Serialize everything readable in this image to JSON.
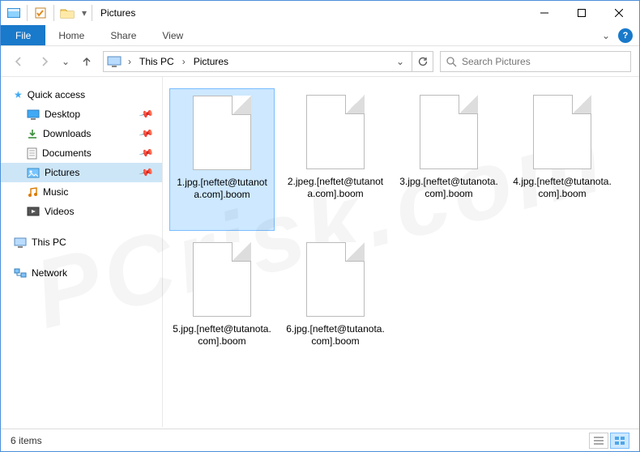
{
  "title": "Pictures",
  "ribbon": {
    "file": "File",
    "tabs": [
      "Home",
      "Share",
      "View"
    ]
  },
  "breadcrumb": {
    "root": "This PC",
    "folder": "Pictures"
  },
  "search": {
    "placeholder": "Search Pictures"
  },
  "sidebar": {
    "quick": {
      "label": "Quick access",
      "items": [
        {
          "label": "Desktop",
          "icon": "desktop",
          "pin": true
        },
        {
          "label": "Downloads",
          "icon": "downloads",
          "pin": true
        },
        {
          "label": "Documents",
          "icon": "documents",
          "pin": true
        },
        {
          "label": "Pictures",
          "icon": "pictures",
          "pin": true,
          "selected": true
        },
        {
          "label": "Music",
          "icon": "music",
          "pin": false
        },
        {
          "label": "Videos",
          "icon": "videos",
          "pin": false
        }
      ]
    },
    "pc": {
      "label": "This PC"
    },
    "network": {
      "label": "Network"
    }
  },
  "files": [
    {
      "name": "1.jpg.[neftet@tutanota.com].boom",
      "selected": true
    },
    {
      "name": "2.jpeg.[neftet@tutanota.com].boom",
      "selected": false
    },
    {
      "name": "3.jpg.[neftet@tutanota.com].boom",
      "selected": false
    },
    {
      "name": "4.jpg.[neftet@tutanota.com].boom",
      "selected": false
    },
    {
      "name": "5.jpg.[neftet@tutanota.com].boom",
      "selected": false
    },
    {
      "name": "6.jpg.[neftet@tutanota.com].boom",
      "selected": false
    }
  ],
  "status": {
    "count": "6 items"
  },
  "watermark": "PCrisk.com"
}
